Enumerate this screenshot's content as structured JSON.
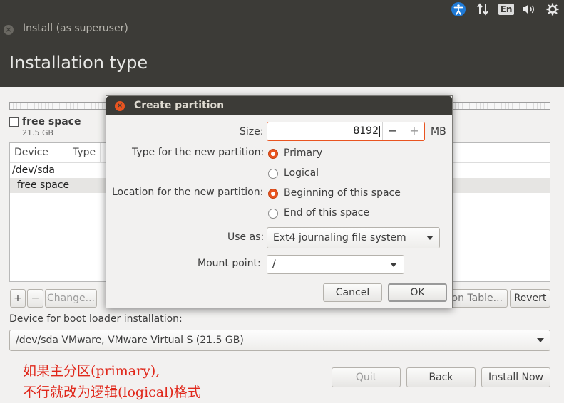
{
  "topbar": {
    "icons": [
      "accessibility-icon",
      "network-arrows-icon",
      "keyboard-layout-icon",
      "volume-icon",
      "settings-gear-icon"
    ],
    "keyboard_layout": "En"
  },
  "window": {
    "title": "Install (as superuser)",
    "page_title": "Installation type"
  },
  "partition_summary": {
    "name": "free space",
    "size": "21.5 GB"
  },
  "table": {
    "columns": [
      "Device",
      "Type"
    ],
    "rows": [
      {
        "device": "/dev/sda"
      },
      {
        "device": "free space",
        "selected": true
      }
    ]
  },
  "table_buttons": {
    "add": "+",
    "remove": "−",
    "change": "Change...",
    "new_table": "ion Table...",
    "revert": "Revert"
  },
  "boot_loader": {
    "label": "Device for boot loader installation:",
    "value": "/dev/sda VMware, VMware Virtual S (21.5 GB)"
  },
  "annotation": {
    "line1": "如果主分区(primary),",
    "line2": "不行就改为逻辑(logical)格式"
  },
  "footer_buttons": {
    "quit": "Quit",
    "back": "Back",
    "install_now": "Install Now"
  },
  "dialog": {
    "title": "Create partition",
    "size_label": "Size:",
    "size_value": "8192",
    "size_unit": "MB",
    "minus": "−",
    "plus": "+",
    "type_label": "Type for the new partition:",
    "type_options": [
      "Primary",
      "Logical"
    ],
    "type_selected": "Primary",
    "location_label": "Location for the new partition:",
    "location_options": [
      "Beginning of this space",
      "End of this space"
    ],
    "location_selected": "Beginning of this space",
    "use_as_label": "Use as:",
    "use_as_value": "Ext4 journaling file system",
    "mount_label": "Mount point:",
    "mount_value": "/",
    "cancel": "Cancel",
    "ok": "OK"
  },
  "colors": {
    "accent": "#e95420",
    "chrome": "#3c3b37",
    "annotation": "#e0281b"
  }
}
